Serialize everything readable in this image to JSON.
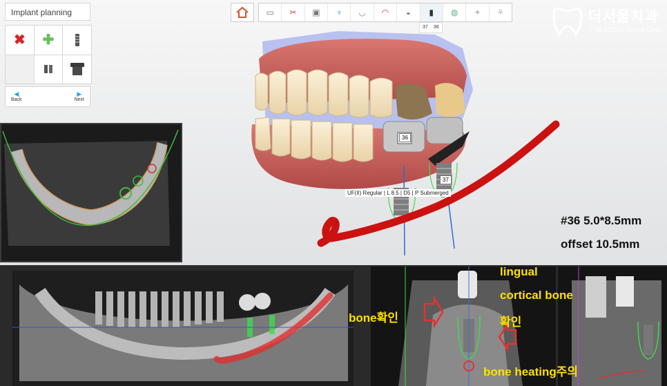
{
  "panel": {
    "title": "Implant planning",
    "nav": {
      "back": "Back",
      "next": "Next"
    }
  },
  "toolbar": {
    "tooth_numbers": [
      "37",
      "36"
    ]
  },
  "brand": {
    "name_kr": "더서울치과",
    "name_en": "THE SEOUL Dental Clinic"
  },
  "model": {
    "implant_tag_36": "36",
    "implant_tag_37": "37",
    "implant_spec": "UF(II) Regular | L 8.5 | D5 | P Submerged"
  },
  "info": {
    "line1": "#36  5.0*8.5mm",
    "line2": "offset  10.5mm"
  },
  "annotations": {
    "bone_check": "bone확인",
    "lingual": "lingual",
    "cortical": "cortical bone",
    "check": "확인",
    "heating": "bone heating주의"
  },
  "colors": {
    "nerve_canal": "#cc1111",
    "annotation_text": "#ffe000",
    "implant_outline": "#3ddc4a"
  },
  "icons": {
    "delete": "x-icon",
    "add": "plus-icon",
    "implant": "implant-icon",
    "abutment": "abutment-icon",
    "crown": "crown-icon"
  }
}
